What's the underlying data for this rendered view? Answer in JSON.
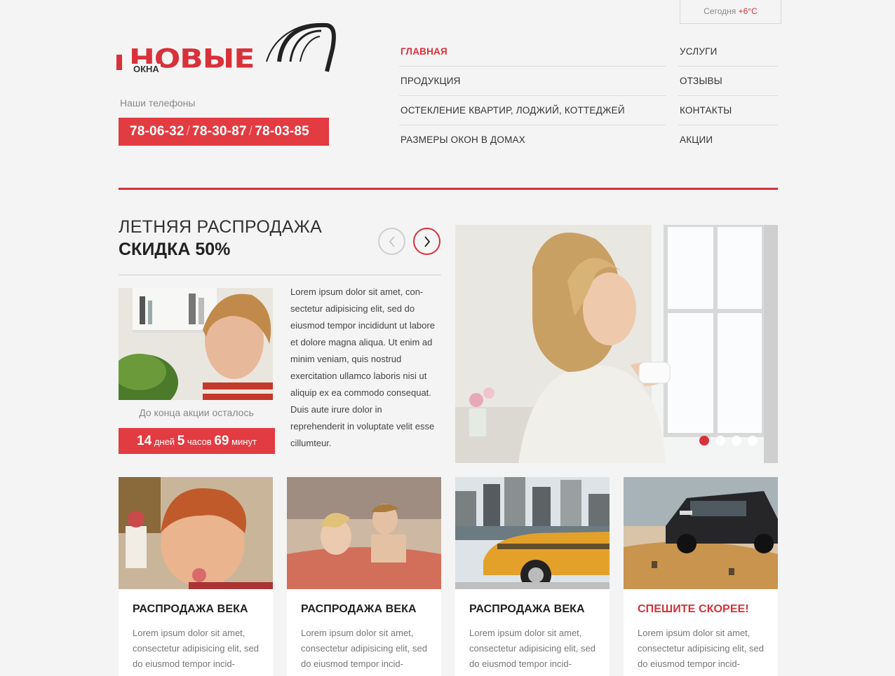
{
  "weather": {
    "label": "Сегодня",
    "temp": "+6°C"
  },
  "logo": {
    "main": "НОВЫЕ",
    "small": "ОКНА"
  },
  "phones": {
    "label": "Наши телефоны",
    "numbers": [
      "78-06-32",
      "78-30-87",
      "78-03-85"
    ]
  },
  "nav": {
    "left": [
      "ГЛАВНАЯ",
      "ПРОДУКЦИЯ",
      "ОСТЕКЛЕНИЕ КВАРТИР, ЛОДЖИЙ, КОТТЕДЖЕЙ",
      "РАЗМЕРЫ ОКОН В ДОМАХ"
    ],
    "right": [
      "УСЛУГИ",
      "ОТЗЫВЫ",
      "КОНТАКТЫ",
      "АКЦИИ"
    ]
  },
  "promo": {
    "title1": "ЛЕТНЯЯ РАСПРОДАЖА",
    "title2": "СКИДКА 50%",
    "countdown_label": "До конца акции осталось",
    "countdown": {
      "days": "14",
      "days_label": "дней",
      "hours": "5",
      "hours_label": "часов",
      "minutes": "69",
      "minutes_label": "минут"
    },
    "text": "Lorem ipsum dolor sit amet, con-sectetur adipisicing elit, sed do eiusmod tempor incididunt ut labore et dolore magna aliqua. Ut enim ad minim veniam, quis nostrud exercitation ullamco laboris nisi ut aliquip ex ea commodo consequat. Duis aute irure dolor in reprehenderit in voluptate velit esse cillumteur."
  },
  "slider": {
    "slide_count": 4,
    "active": 1
  },
  "cards": [
    {
      "title": "РАСПРОДАЖА ВЕКА",
      "text": "Lorem ipsum dolor sit amet, consectetur adipisicing elit, sed do eiusmod tempor incid-"
    },
    {
      "title": "РАСПРОДАЖА ВЕКА",
      "text": "Lorem ipsum dolor sit amet, consectetur adipisicing elit, sed do eiusmod tempor incid-"
    },
    {
      "title": "РАСПРОДАЖА ВЕКА",
      "text": "Lorem ipsum dolor sit amet, consectetur adipisicing elit, sed do eiusmod tempor incid-"
    },
    {
      "title": "СПЕШИТЕ СКОРЕЕ!",
      "text": "Lorem ipsum dolor sit amet, consectetur adipisicing elit, sed do eiusmod tempor incid-"
    }
  ],
  "colors": {
    "accent": "#d9313a",
    "accent_bg": "#e23b41",
    "background": "#f4f4f4"
  }
}
